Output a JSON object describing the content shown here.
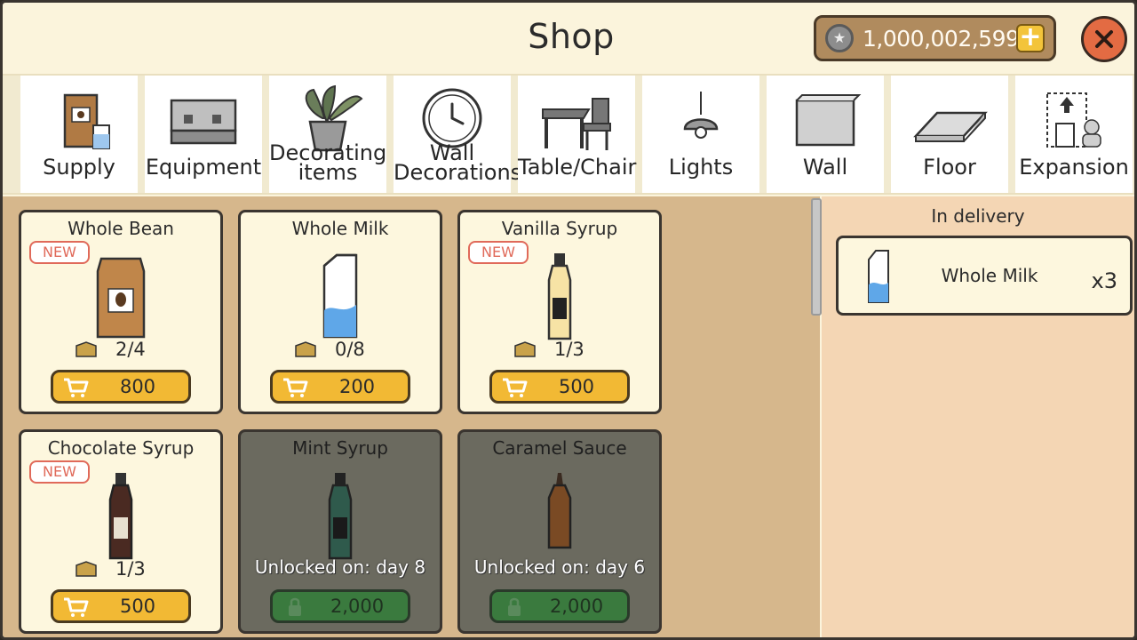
{
  "header": {
    "title": "Shop",
    "coins": "1,000,002,599",
    "coin_icon": "star-coin-icon",
    "add_coins_icon": "plus-icon",
    "close_icon": "close-icon"
  },
  "tabs": [
    {
      "label": "Supply",
      "icon": "supply-bag-icon"
    },
    {
      "label": "Equipment",
      "icon": "espresso-machine-icon"
    },
    {
      "label": "Decorating items",
      "icon": "potted-plant-icon"
    },
    {
      "label": "Wall Decorations",
      "icon": "wall-clock-icon"
    },
    {
      "label": "Table/Chair",
      "icon": "table-chair-icon"
    },
    {
      "label": "Lights",
      "icon": "pendant-lamp-icon"
    },
    {
      "label": "Wall",
      "icon": "wall-panel-icon"
    },
    {
      "label": "Floor",
      "icon": "floor-tile-icon"
    },
    {
      "label": "Expansion",
      "icon": "expansion-icon"
    }
  ],
  "products": [
    {
      "name": "Whole Bean",
      "badge": "NEW",
      "stock": "2/4",
      "price": "800",
      "locked": false,
      "icon": "coffee-bag-icon"
    },
    {
      "name": "Whole Milk",
      "badge": "",
      "stock": "0/8",
      "price": "200",
      "locked": false,
      "icon": "milk-carton-icon"
    },
    {
      "name": "Vanilla Syrup",
      "badge": "NEW",
      "stock": "1/3",
      "price": "500",
      "locked": false,
      "icon": "vanilla-syrup-bottle-icon"
    },
    {
      "name": "Chocolate Syrup",
      "badge": "NEW",
      "stock": "1/3",
      "price": "500",
      "locked": false,
      "icon": "chocolate-syrup-bottle-icon"
    },
    {
      "name": "Mint Syrup",
      "badge": "",
      "stock": "",
      "price": "2,000",
      "locked": true,
      "unlock": "Unlocked on: day 8",
      "icon": "mint-syrup-bottle-icon"
    },
    {
      "name": "Caramel Sauce",
      "badge": "",
      "stock": "",
      "price": "2,000",
      "locked": true,
      "unlock": "Unlocked on: day 6",
      "icon": "caramel-sauce-bottle-icon"
    }
  ],
  "delivery": {
    "title": "In delivery",
    "items": [
      {
        "name": "Whole Milk",
        "qty": "x3",
        "icon": "milk-carton-icon"
      }
    ]
  },
  "colors": {
    "accent_yellow": "#f2b934",
    "locked_green": "#3a7a3e",
    "close_red": "#e36b43",
    "new_badge": "#e06a5a"
  }
}
